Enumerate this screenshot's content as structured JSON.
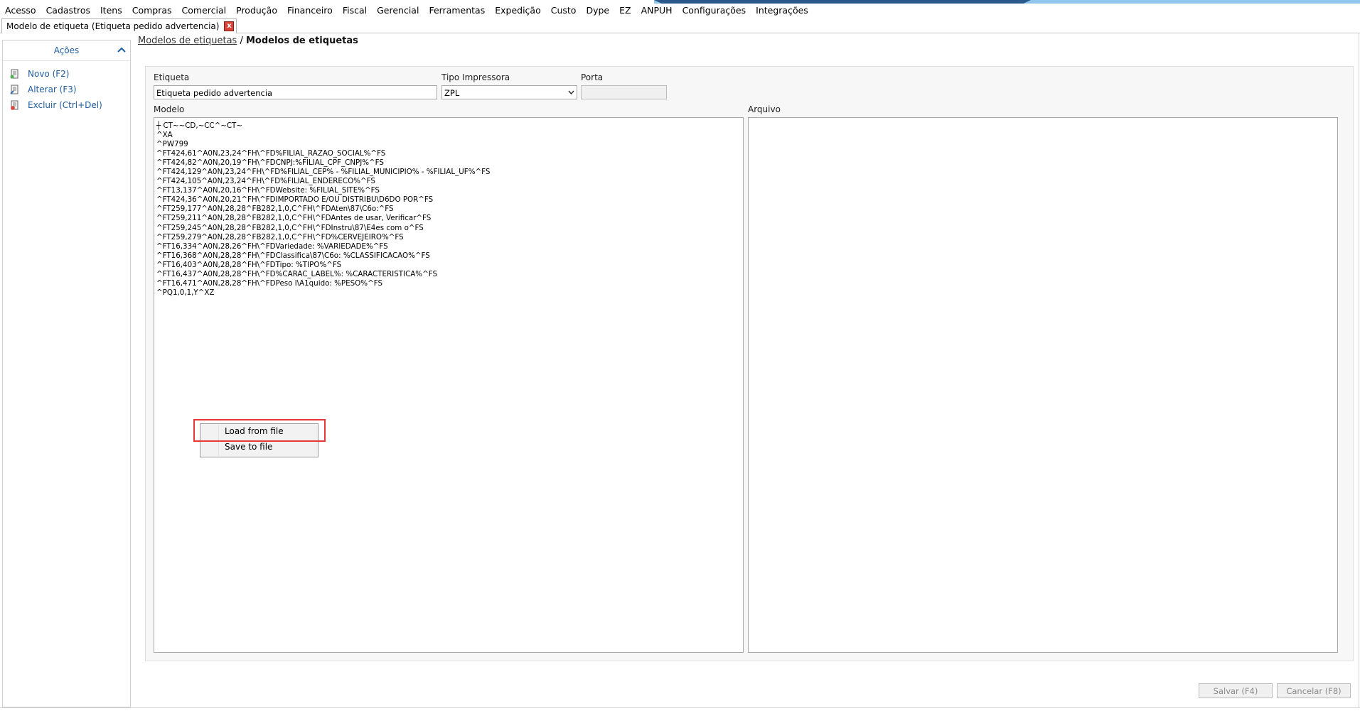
{
  "menu": [
    "Acesso",
    "Cadastros",
    "Itens",
    "Compras",
    "Comercial",
    "Produção",
    "Financeiro",
    "Fiscal",
    "Gerencial",
    "Ferramentas",
    "Expedição",
    "Custo",
    "Dype",
    "EZ",
    "ANPUH",
    "Configurações",
    "Integrações"
  ],
  "tab": {
    "title": "Modelo de etiqueta (Etiqueta pedido advertencia)",
    "close": "x"
  },
  "sidebar": {
    "title": "Ações",
    "actions": [
      {
        "label": "Novo (F2)",
        "icon": "new-document-icon"
      },
      {
        "label": "Alterar (F3)",
        "icon": "edit-document-icon"
      },
      {
        "label": "Excluir (Ctrl+Del)",
        "icon": "delete-document-icon"
      }
    ]
  },
  "breadcrumb": {
    "link": "Modelos de etiquetas",
    "separator": "/",
    "current": "Modelos de etiquetas"
  },
  "form": {
    "etiqueta_label": "Etiqueta",
    "etiqueta_value": "Etiqueta pedido advertencia",
    "tipo_label": "Tipo Impressora",
    "tipo_value": "ZPL",
    "porta_label": "Porta",
    "porta_value": "",
    "modelo_label": "Modelo",
    "arquivo_label": "Arquivo",
    "modelo_lines": [
      "┼ CT~~CD,~CC^~CT~",
      "^XA",
      "^PW799",
      "^FT424,61^A0N,23,24^FH\\^FD%FILIAL_RAZAO_SOCIAL%^FS",
      "^FT424,82^A0N,20,19^FH\\^FDCNPJ:%FILIAL_CPF_CNPJ%^FS",
      "^FT424,129^A0N,23,24^FH\\^FD%FILIAL_CEP% - %FILIAL_MUNICIPIO% - %FILIAL_UF%^FS",
      "^FT424,105^A0N,23,24^FH\\^FD%FILIAL_ENDERECO%^FS",
      "^FT13,137^A0N,20,16^FH\\^FDWebsite: %FILIAL_SITE%^FS",
      "^FT424,36^A0N,20,21^FH\\^FDIMPORTADO E/OU DISTRIBU\\D6DO POR^FS",
      "^FT259,177^A0N,28,28^FB282,1,0,C^FH\\^FDAten\\87\\C6o:^FS",
      "^FT259,211^A0N,28,28^FB282,1,0,C^FH\\^FDAntes de usar, Verificar^FS",
      "^FT259,245^A0N,28,28^FB282,1,0,C^FH\\^FDInstru\\87\\E4es com o^FS",
      "^FT259,279^A0N,28,28^FB282,1,0,C^FH\\^FD%CERVEJEIRO%^FS",
      "^FT16,334^A0N,28,26^FH\\^FDVariedade: %VARIEDADE%^FS",
      "^FT16,368^A0N,28,28^FH\\^FDClassifica\\87\\C6o: %CLASSIFICACAO%^FS",
      "^FT16,403^A0N,28,28^FH\\^FDTipo: %TIPO%^FS",
      "^FT16,437^A0N,28,28^FH\\^FD%CARAC_LABEL%: %CARACTERISTICA%^FS",
      "^FT16,471^A0N,28,28^FH\\^FDPeso l\\A1quido: %PESO%^FS",
      "^PQ1,0,1,Y^XZ"
    ]
  },
  "context_menu": {
    "items": [
      "Load from file",
      "Save to file"
    ]
  },
  "buttons": {
    "save": "Salvar (F4)",
    "cancel": "Cancelar (F8)"
  },
  "colors": {
    "link": "#1f5da0",
    "highlight": "#e53935",
    "close": "#d9443a"
  }
}
